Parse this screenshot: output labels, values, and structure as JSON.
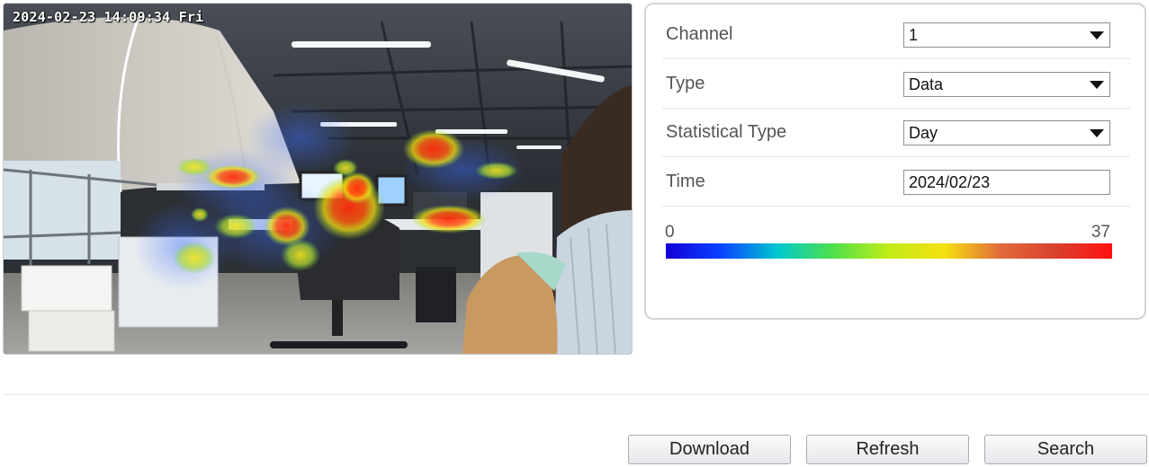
{
  "video": {
    "osd_text": "2024-02-23 14:09:34 Fri"
  },
  "settings": {
    "channel": {
      "label": "Channel",
      "value": "1"
    },
    "type": {
      "label": "Type",
      "value": "Data"
    },
    "statistical_type": {
      "label": "Statistical Type",
      "value": "Day"
    },
    "time": {
      "label": "Time",
      "value": "2024/02/23"
    }
  },
  "scale": {
    "min": "0",
    "max": "37",
    "colors": [
      "#1200d6",
      "#0a44ff",
      "#00c8d0",
      "#4fe04a",
      "#c2ec18",
      "#f5e010",
      "#e06a3a",
      "#d9402f",
      "#ff1010"
    ]
  },
  "buttons": {
    "download": "Download",
    "refresh": "Refresh",
    "search": "Search"
  }
}
